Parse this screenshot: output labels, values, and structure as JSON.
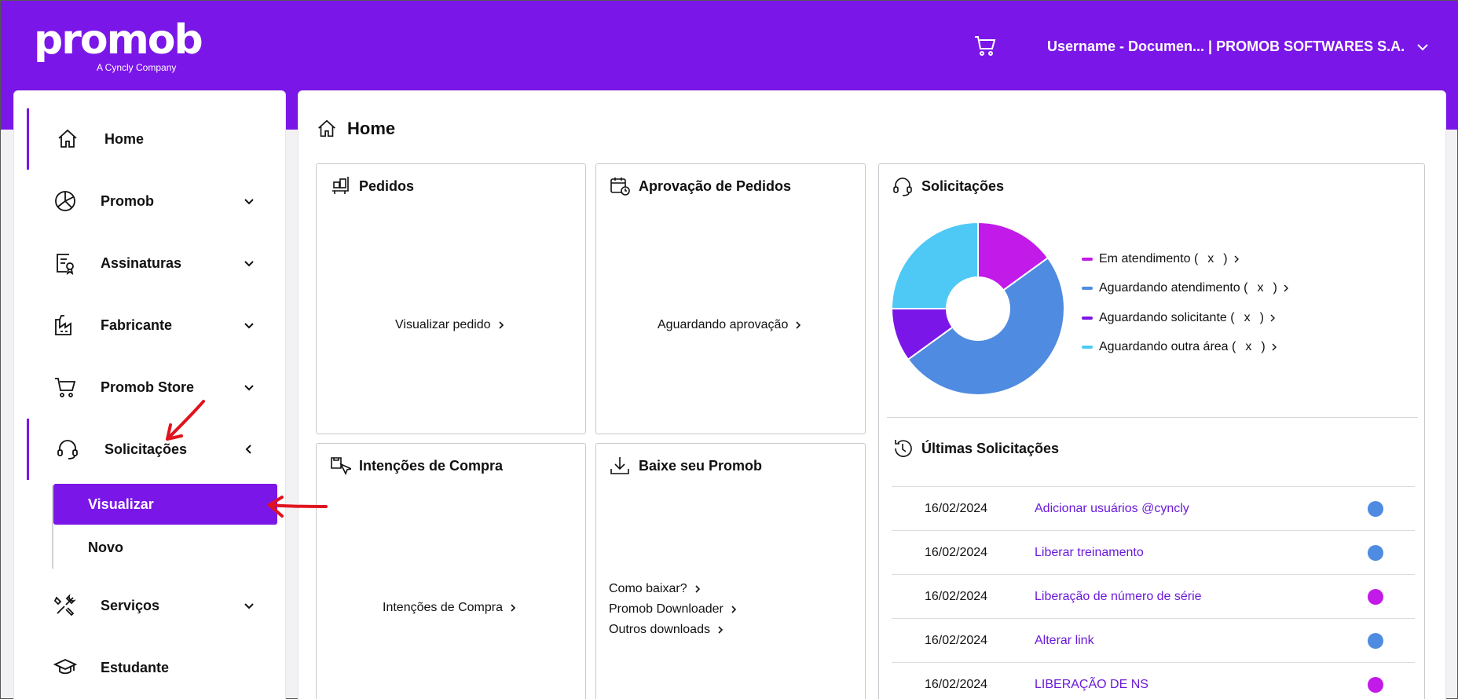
{
  "header": {
    "logo_text": "promob",
    "logo_tagline": "A Cyncly Company",
    "user_label": "Username - Documen... | PROMOB SOFTWARES S.A."
  },
  "sidebar": {
    "items": [
      {
        "label": "Home",
        "icon": "home-icon"
      },
      {
        "label": "Promob",
        "icon": "promob-icon"
      },
      {
        "label": "Assinaturas",
        "icon": "document-badge-icon"
      },
      {
        "label": "Fabricante",
        "icon": "factory-icon"
      },
      {
        "label": "Promob Store",
        "icon": "cart-icon"
      },
      {
        "label": "Solicitações",
        "icon": "headset-icon"
      },
      {
        "label": "Serviços",
        "icon": "tools-icon"
      },
      {
        "label": "Estudante",
        "icon": "graduation-cap-icon"
      }
    ],
    "submenu": [
      {
        "label": "Visualizar"
      },
      {
        "label": "Novo"
      }
    ]
  },
  "main": {
    "title": "Home",
    "cards": {
      "pedidos": {
        "title": "Pedidos",
        "link": "Visualizar pedido"
      },
      "aprovacao": {
        "title": "Aprovação de Pedidos",
        "link": "Aguardando aprovação"
      },
      "intencoes": {
        "title": "Intenções de Compra",
        "link": "Intenções de Compra"
      },
      "baixe": {
        "title": "Baixe seu Promob",
        "links": [
          "Como baixar?",
          "Promob Downloader",
          "Outros downloads"
        ]
      },
      "solicitacoes": {
        "title": "Solicitações",
        "legend": [
          {
            "label": "Em atendimento (",
            "value": "x",
            "color": "#c21ae8"
          },
          {
            "label": "Aguardando atendimento (",
            "value": "x",
            "color": "#4f8be0"
          },
          {
            "label": "Aguardando solicitante (",
            "value": "x",
            "color": "#7b16e8"
          },
          {
            "label": "Aguardando outra área (",
            "value": "x",
            "color": "#4ec9f5"
          }
        ],
        "close_paren": ")",
        "recent_title": "Últimas Solicitações",
        "recent": [
          {
            "date": "16/02/2024",
            "title": "Adicionar usuários @cyncly",
            "color": "#4f8be0"
          },
          {
            "date": "16/02/2024",
            "title": "Liberar treinamento",
            "color": "#4f8be0"
          },
          {
            "date": "16/02/2024",
            "title": "Liberação de número de série",
            "color": "#c21ae8"
          },
          {
            "date": "16/02/2024",
            "title": "Alterar link",
            "color": "#4f8be0"
          },
          {
            "date": "16/02/2024",
            "title": "LIBERAÇÃO DE NS",
            "color": "#c21ae8"
          }
        ]
      }
    }
  },
  "chart_data": {
    "type": "pie",
    "categories": [
      "Em atendimento",
      "Aguardando atendimento",
      "Aguardando solicitante",
      "Aguardando outra área"
    ],
    "values": [
      15,
      50,
      10,
      25
    ],
    "colors": [
      "#c21ae8",
      "#4f8be0",
      "#7b16e8",
      "#4ec9f5"
    ]
  },
  "colors": {
    "brand": "#7b16e8",
    "link": "#6a1ad8",
    "annotation_arrow": "#e0141e"
  }
}
